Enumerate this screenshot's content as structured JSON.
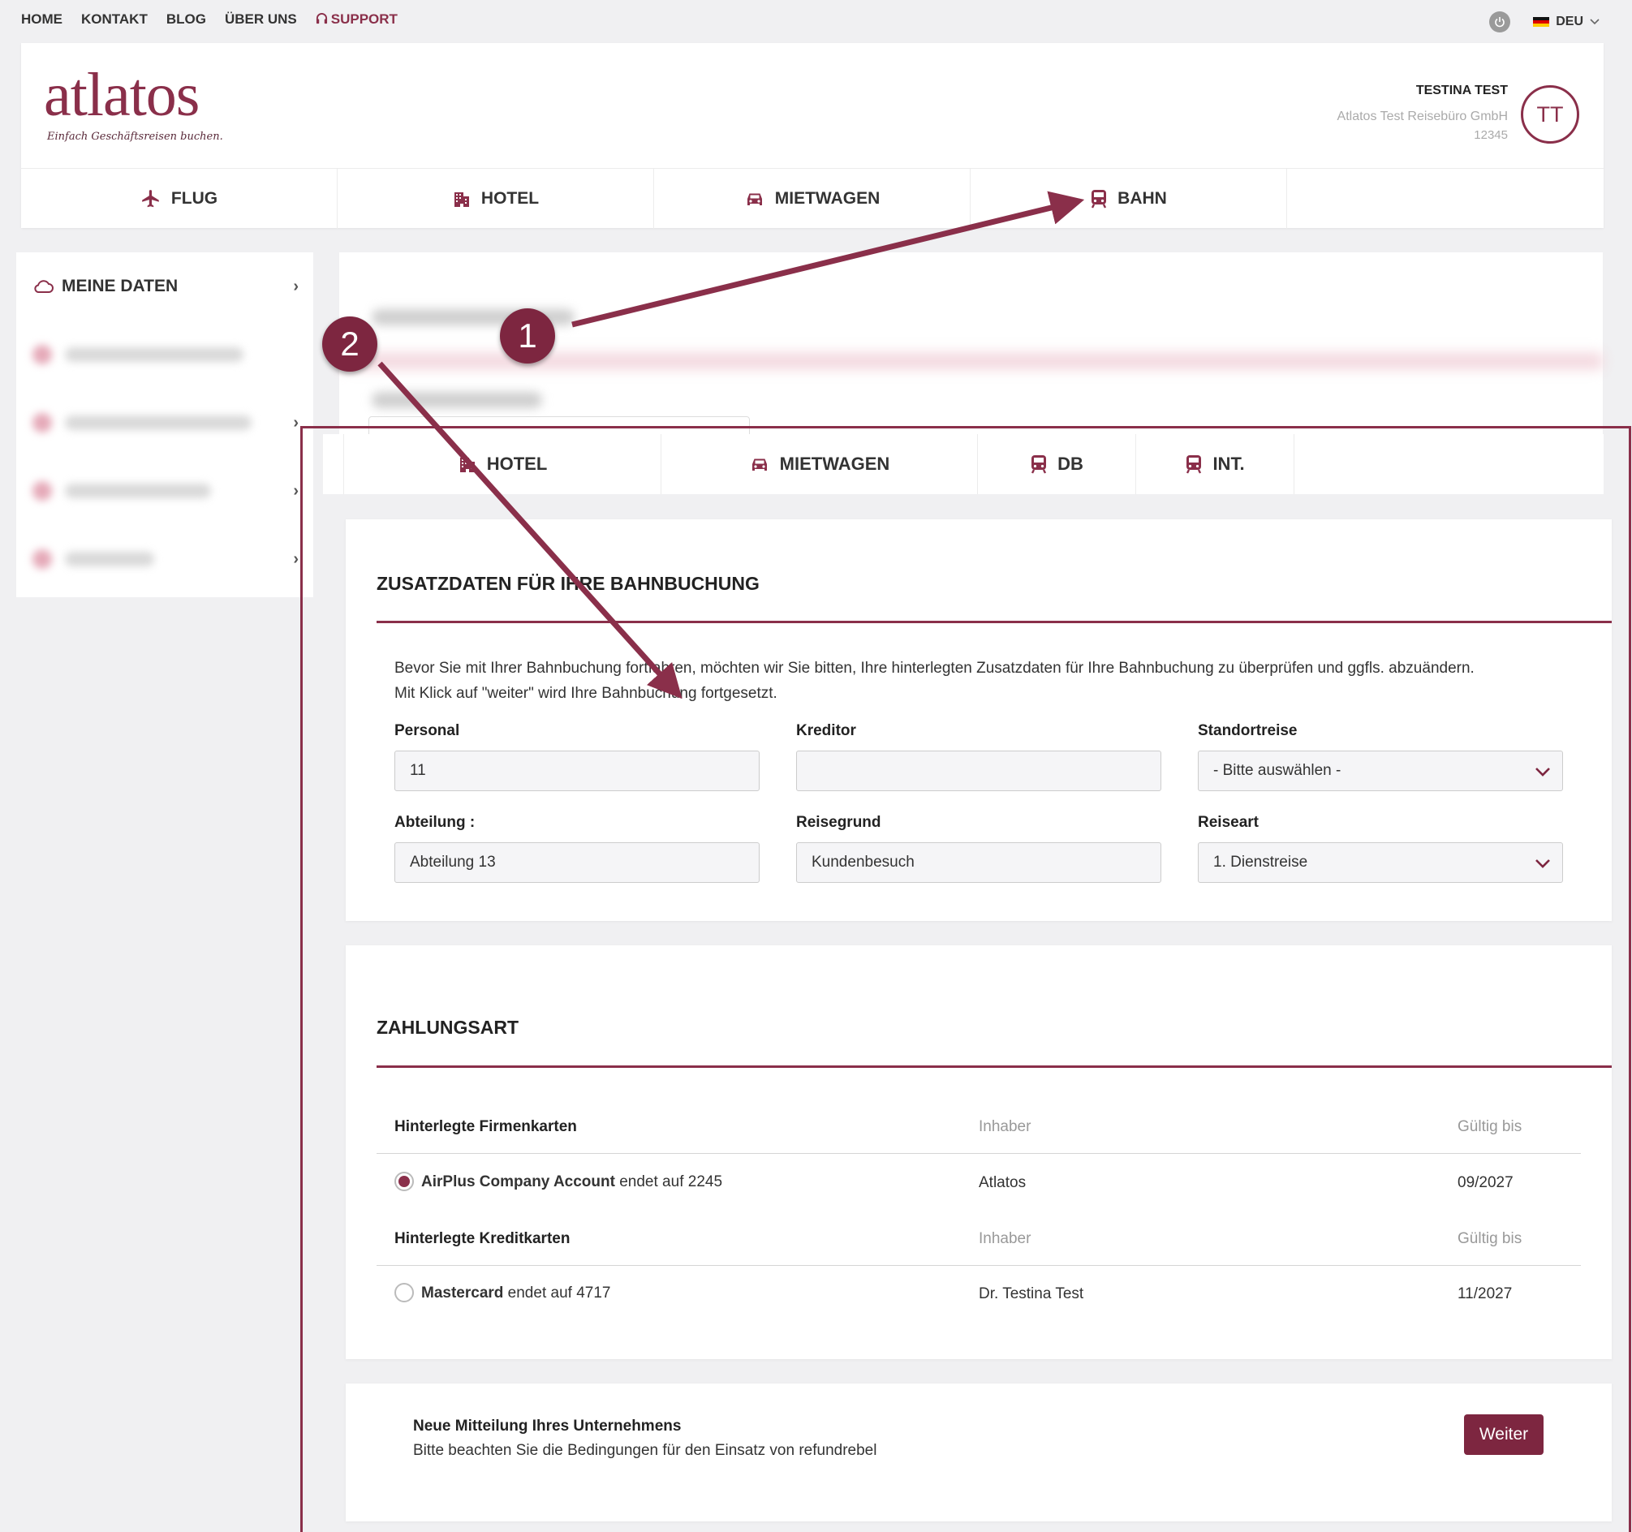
{
  "topnav": {
    "home": "HOME",
    "kontakt": "KONTAKT",
    "blog": "BLOG",
    "ueber_uns": "ÜBER UNS",
    "support": "SUPPORT",
    "language": "DEU"
  },
  "brand": {
    "name": "atlatos",
    "tagline": "Einfach Geschäftsreisen buchen.",
    "color": "#8a2f4a"
  },
  "user": {
    "name": "TESTINA TEST",
    "company": "Atlatos Test Reisebüro GmbH",
    "code": "12345",
    "initials": "TT"
  },
  "main_tabs": [
    {
      "label": "FLUG",
      "icon": "plane-icon"
    },
    {
      "label": "HOTEL",
      "icon": "building-icon"
    },
    {
      "label": "MIETWAGEN",
      "icon": "car-icon"
    },
    {
      "label": "BAHN",
      "icon": "train-icon"
    }
  ],
  "sidebar": {
    "first_item": "MEINE DATEN"
  },
  "sub_tabs": [
    {
      "label": "HOTEL",
      "icon": "building-icon"
    },
    {
      "label": "MIETWAGEN",
      "icon": "car-icon"
    },
    {
      "label": "DB",
      "icon": "train-icon"
    },
    {
      "label": "INT.",
      "icon": "train-icon"
    }
  ],
  "zusatzdaten": {
    "title": "ZUSATZDATEN FÜR IHRE BAHNBUCHUNG",
    "intro_line1": "Bevor Sie mit Ihrer Bahnbuchung fortfahren, möchten wir Sie bitten, Ihre hinterlegten Zusatzdaten für Ihre Bahnbuchung zu überprüfen und ggfls. abzuändern.",
    "intro_line2": "Mit Klick auf \"weiter\" wird Ihre Bahnbuchung fortgesetzt.",
    "fields": {
      "personal": {
        "label": "Personal",
        "value": "11"
      },
      "kreditor": {
        "label": "Kreditor",
        "value": ""
      },
      "standortreise": {
        "label": "Standortreise",
        "value": "- Bitte auswählen -"
      },
      "abteilung": {
        "label": "Abteilung :",
        "value": "Abteilung 13"
      },
      "reisegrund": {
        "label": "Reisegrund",
        "value": "Kundenbesuch"
      },
      "reiseart": {
        "label": "Reiseart",
        "value": "1. Dienstreise"
      }
    }
  },
  "zahlungsart": {
    "title": "ZAHLUNGSART",
    "firmenkarten_header": "Hinterlegte Firmenkarten",
    "kreditkarten_header": "Hinterlegte Kreditkarten",
    "inhaber_header": "Inhaber",
    "gueltig_header": "Gültig bis",
    "firmenkarte": {
      "name": "AirPlus Company Account",
      "suffix": "endet auf 2245",
      "inhaber": "Atlatos",
      "gueltig": "09/2027",
      "selected": true
    },
    "kreditkarte": {
      "name": "Mastercard",
      "suffix": "endet auf 4717",
      "inhaber": "Dr. Testina Test",
      "gueltig": "11/2027",
      "selected": false
    }
  },
  "notice": {
    "title": "Neue Mitteilung Ihres Unternehmens",
    "text": "Bitte beachten Sie die Bedingungen für den Einsatz von refundrebel",
    "button": "Weiter"
  },
  "annotations": {
    "badge1": "1",
    "badge2": "2"
  }
}
